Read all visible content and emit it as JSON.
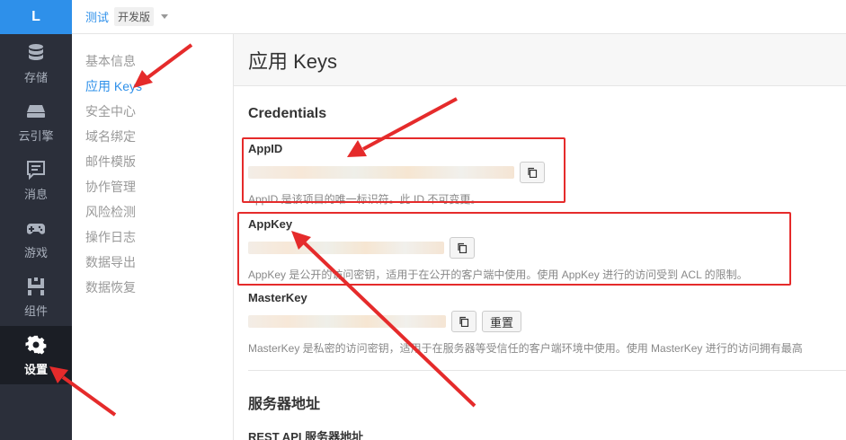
{
  "logo": "L",
  "sidebar": {
    "items": [
      {
        "label": "存储",
        "icon": "database-icon"
      },
      {
        "label": "云引擎",
        "icon": "server-icon"
      },
      {
        "label": "消息",
        "icon": "message-icon"
      },
      {
        "label": "游戏",
        "icon": "gamepad-icon"
      },
      {
        "label": "组件",
        "icon": "component-icon"
      },
      {
        "label": "设置",
        "icon": "gear-icon",
        "active": true
      }
    ]
  },
  "topbar": {
    "app_name": "测试",
    "env_badge": "开发版"
  },
  "submenu": {
    "items": [
      "基本信息",
      "应用 Keys",
      "安全中心",
      "域名绑定",
      "邮件模版",
      "协作管理",
      "风险检测",
      "操作日志",
      "数据导出",
      "数据恢复"
    ],
    "active_index": 1
  },
  "page": {
    "title": "应用 Keys",
    "credentials_title": "Credentials",
    "appid": {
      "label": "AppID",
      "desc": "AppID 是该项目的唯一标识符。此 ID 不可变更。"
    },
    "appkey": {
      "label": "AppKey",
      "desc": "AppKey 是公开的访问密钥，适用于在公开的客户端中使用。使用 AppKey 进行的访问受到 ACL 的限制。"
    },
    "masterkey": {
      "label": "MasterKey",
      "reset_label": "重置",
      "desc": "MasterKey 是私密的访问密钥，适用于在服务器等受信任的客户端环境中使用。使用 MasterKey 进行的访问拥有最高"
    },
    "server_title": "服务器地址",
    "rest_label": "REST API 服务器地址"
  },
  "colors": {
    "accent": "#2e90ea",
    "annotation": "#e52b2b",
    "sidebar_bg": "#2b2f3a"
  }
}
